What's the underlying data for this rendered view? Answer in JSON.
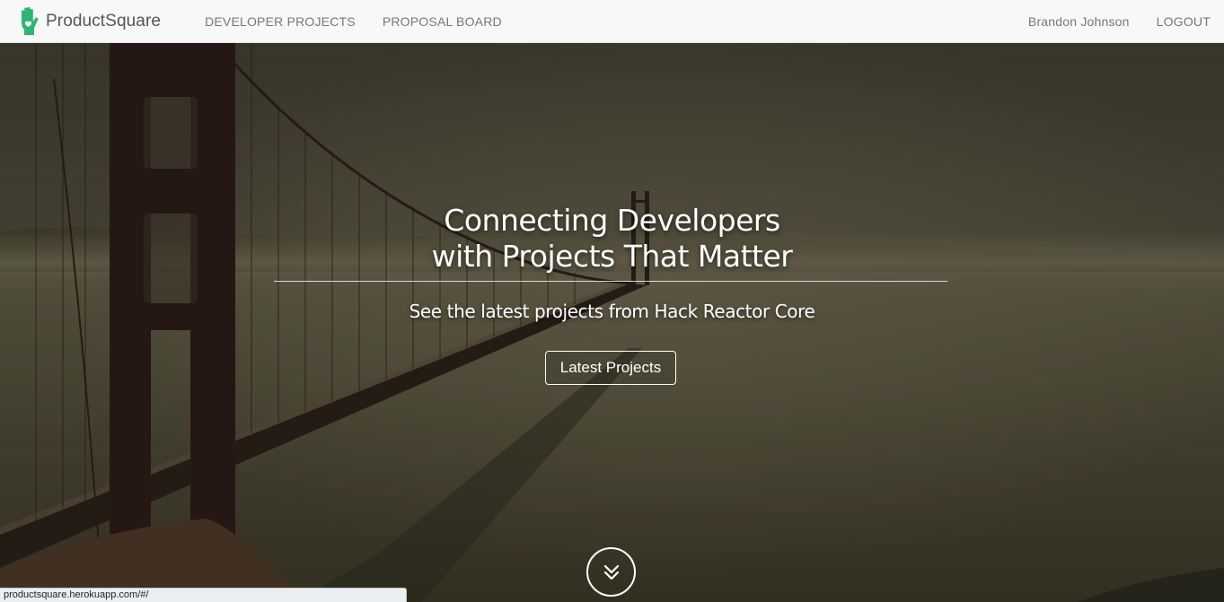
{
  "nav": {
    "brand": "ProductSquare",
    "links": [
      "DEVELOPER PROJECTS",
      "PROPOSAL BOARD"
    ],
    "user": "Brandon Johnson",
    "logout": "LOGOUT"
  },
  "hero": {
    "title_line1": "Connecting Developers",
    "title_line2": "with Projects That Matter",
    "subtitle": "See the latest projects from Hack Reactor Core",
    "cta": "Latest Projects"
  },
  "status_bar": {
    "url": "productsquare.herokuapp.com/#/"
  },
  "icons": {
    "logo": "hand-heart-icon",
    "scroll": "double-chevron-down-icon"
  },
  "colors": {
    "brand": "#2bb673",
    "nav_bg": "#f8f8f8",
    "nav_text": "#777777"
  }
}
